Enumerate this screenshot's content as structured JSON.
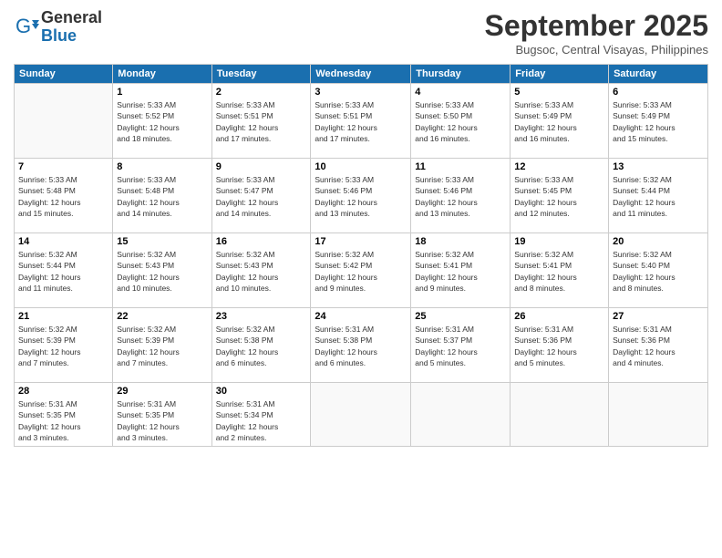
{
  "header": {
    "logo_line1": "General",
    "logo_line2": "Blue",
    "month_title": "September 2025",
    "location": "Bugsoc, Central Visayas, Philippines"
  },
  "days_of_week": [
    "Sunday",
    "Monday",
    "Tuesday",
    "Wednesday",
    "Thursday",
    "Friday",
    "Saturday"
  ],
  "weeks": [
    [
      {
        "day": "",
        "info": ""
      },
      {
        "day": "1",
        "info": "Sunrise: 5:33 AM\nSunset: 5:52 PM\nDaylight: 12 hours\nand 18 minutes."
      },
      {
        "day": "2",
        "info": "Sunrise: 5:33 AM\nSunset: 5:51 PM\nDaylight: 12 hours\nand 17 minutes."
      },
      {
        "day": "3",
        "info": "Sunrise: 5:33 AM\nSunset: 5:51 PM\nDaylight: 12 hours\nand 17 minutes."
      },
      {
        "day": "4",
        "info": "Sunrise: 5:33 AM\nSunset: 5:50 PM\nDaylight: 12 hours\nand 16 minutes."
      },
      {
        "day": "5",
        "info": "Sunrise: 5:33 AM\nSunset: 5:49 PM\nDaylight: 12 hours\nand 16 minutes."
      },
      {
        "day": "6",
        "info": "Sunrise: 5:33 AM\nSunset: 5:49 PM\nDaylight: 12 hours\nand 15 minutes."
      }
    ],
    [
      {
        "day": "7",
        "info": "Sunrise: 5:33 AM\nSunset: 5:48 PM\nDaylight: 12 hours\nand 15 minutes."
      },
      {
        "day": "8",
        "info": "Sunrise: 5:33 AM\nSunset: 5:48 PM\nDaylight: 12 hours\nand 14 minutes."
      },
      {
        "day": "9",
        "info": "Sunrise: 5:33 AM\nSunset: 5:47 PM\nDaylight: 12 hours\nand 14 minutes."
      },
      {
        "day": "10",
        "info": "Sunrise: 5:33 AM\nSunset: 5:46 PM\nDaylight: 12 hours\nand 13 minutes."
      },
      {
        "day": "11",
        "info": "Sunrise: 5:33 AM\nSunset: 5:46 PM\nDaylight: 12 hours\nand 13 minutes."
      },
      {
        "day": "12",
        "info": "Sunrise: 5:33 AM\nSunset: 5:45 PM\nDaylight: 12 hours\nand 12 minutes."
      },
      {
        "day": "13",
        "info": "Sunrise: 5:32 AM\nSunset: 5:44 PM\nDaylight: 12 hours\nand 11 minutes."
      }
    ],
    [
      {
        "day": "14",
        "info": "Sunrise: 5:32 AM\nSunset: 5:44 PM\nDaylight: 12 hours\nand 11 minutes."
      },
      {
        "day": "15",
        "info": "Sunrise: 5:32 AM\nSunset: 5:43 PM\nDaylight: 12 hours\nand 10 minutes."
      },
      {
        "day": "16",
        "info": "Sunrise: 5:32 AM\nSunset: 5:43 PM\nDaylight: 12 hours\nand 10 minutes."
      },
      {
        "day": "17",
        "info": "Sunrise: 5:32 AM\nSunset: 5:42 PM\nDaylight: 12 hours\nand 9 minutes."
      },
      {
        "day": "18",
        "info": "Sunrise: 5:32 AM\nSunset: 5:41 PM\nDaylight: 12 hours\nand 9 minutes."
      },
      {
        "day": "19",
        "info": "Sunrise: 5:32 AM\nSunset: 5:41 PM\nDaylight: 12 hours\nand 8 minutes."
      },
      {
        "day": "20",
        "info": "Sunrise: 5:32 AM\nSunset: 5:40 PM\nDaylight: 12 hours\nand 8 minutes."
      }
    ],
    [
      {
        "day": "21",
        "info": "Sunrise: 5:32 AM\nSunset: 5:39 PM\nDaylight: 12 hours\nand 7 minutes."
      },
      {
        "day": "22",
        "info": "Sunrise: 5:32 AM\nSunset: 5:39 PM\nDaylight: 12 hours\nand 7 minutes."
      },
      {
        "day": "23",
        "info": "Sunrise: 5:32 AM\nSunset: 5:38 PM\nDaylight: 12 hours\nand 6 minutes."
      },
      {
        "day": "24",
        "info": "Sunrise: 5:31 AM\nSunset: 5:38 PM\nDaylight: 12 hours\nand 6 minutes."
      },
      {
        "day": "25",
        "info": "Sunrise: 5:31 AM\nSunset: 5:37 PM\nDaylight: 12 hours\nand 5 minutes."
      },
      {
        "day": "26",
        "info": "Sunrise: 5:31 AM\nSunset: 5:36 PM\nDaylight: 12 hours\nand 5 minutes."
      },
      {
        "day": "27",
        "info": "Sunrise: 5:31 AM\nSunset: 5:36 PM\nDaylight: 12 hours\nand 4 minutes."
      }
    ],
    [
      {
        "day": "28",
        "info": "Sunrise: 5:31 AM\nSunset: 5:35 PM\nDaylight: 12 hours\nand 3 minutes."
      },
      {
        "day": "29",
        "info": "Sunrise: 5:31 AM\nSunset: 5:35 PM\nDaylight: 12 hours\nand 3 minutes."
      },
      {
        "day": "30",
        "info": "Sunrise: 5:31 AM\nSunset: 5:34 PM\nDaylight: 12 hours\nand 2 minutes."
      },
      {
        "day": "",
        "info": ""
      },
      {
        "day": "",
        "info": ""
      },
      {
        "day": "",
        "info": ""
      },
      {
        "day": "",
        "info": ""
      }
    ]
  ]
}
